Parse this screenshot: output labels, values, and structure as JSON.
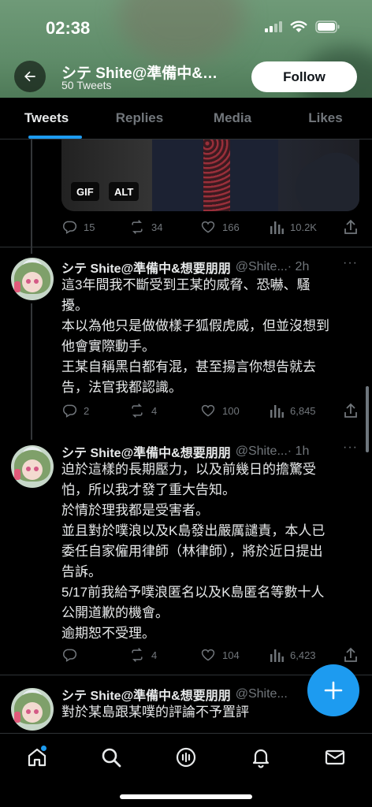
{
  "status_bar": {
    "time": "02:38"
  },
  "profile": {
    "title": "シテ Shite@準備中&…",
    "tweet_count": "50 Tweets",
    "follow_label": "Follow"
  },
  "tabs": [
    {
      "label": "Tweets",
      "active": true
    },
    {
      "label": "Replies",
      "active": false
    },
    {
      "label": "Media",
      "active": false
    },
    {
      "label": "Likes",
      "active": false
    }
  ],
  "prev_tweet": {
    "media_badges": [
      "GIF",
      "ALT"
    ],
    "stats": {
      "replies": "15",
      "retweets": "34",
      "likes": "166",
      "views": "10.2K"
    }
  },
  "tweets": [
    {
      "name": "シテ Shite@準備中&想要朋朋",
      "handle": "@Shite...",
      "time": "· 2h",
      "more": "···",
      "lines": [
        "這3年間我不斷受到王某的威脅、恐嚇、騷",
        "擾。",
        "本以為他只是做做樣子狐假虎威，但並沒想到",
        "他會實際動手。",
        "王某自稱黑白都有混，甚至揚言你想告就去",
        "告，法官我都認識。"
      ],
      "stats": {
        "replies": "2",
        "retweets": "4",
        "likes": "100",
        "views": "6,845"
      }
    },
    {
      "name": "シテ Shite@準備中&想要朋朋",
      "handle": "@Shite...",
      "time": "· 1h",
      "more": "···",
      "lines": [
        "迫於這樣的長期壓力，以及前幾日的擔驚受",
        "怕，所以我才發了重大告知。",
        "於情於理我都是受害者。",
        "並且對於噗浪以及K島發出嚴厲譴責，本人已",
        "委任自家僱用律師（林律師），將於近日提出",
        "告訴。",
        "5/17前我給予噗浪匿名以及K島匿名等數十人",
        "公開道歉的機會。",
        "逾期恕不受理。"
      ],
      "stats": {
        "replies": "",
        "retweets": "4",
        "likes": "104",
        "views": "6,423"
      }
    },
    {
      "name": "シテ Shite@準備中&想要朋朋",
      "handle": "@Shite...",
      "time": "",
      "more": "",
      "lines": [
        "對於某島跟某噗的評論不予置評"
      ],
      "stats": {}
    }
  ],
  "icons": {
    "back": "arrow-left-icon",
    "reply": "speech-bubble-icon",
    "retweet": "retweet-icon",
    "like": "heart-icon",
    "views": "bar-chart-icon",
    "share": "share-icon",
    "compose": "plus-icon",
    "nav": [
      "home-icon",
      "search-icon",
      "spaces-icon",
      "bell-icon",
      "mail-icon"
    ]
  },
  "colors": {
    "accent": "#1d9bf0",
    "background": "#000000",
    "muted": "#71767b",
    "text": "#e7e9ea"
  }
}
